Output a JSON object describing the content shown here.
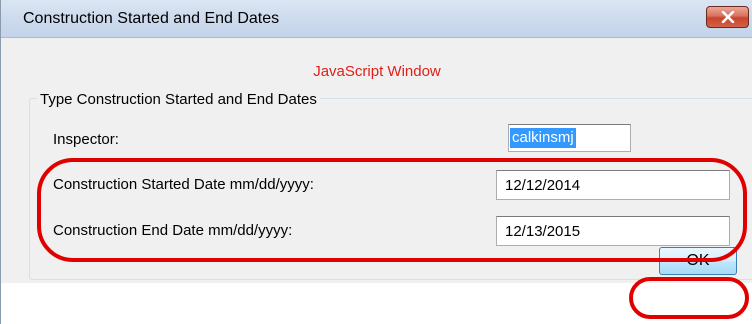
{
  "window": {
    "title": "Construction Started and End Dates"
  },
  "banner": {
    "text": "JavaScript Window",
    "color": "#e0201a"
  },
  "group": {
    "legend": "Type Construction Started and End Dates"
  },
  "fields": {
    "inspector_label": "Inspector:",
    "inspector_value": "calkinsmj",
    "start_label": "Construction Started Date mm/dd/yyyy:",
    "start_value": "12/12/2014",
    "end_label": "Construction End Date mm/dd/yyyy:",
    "end_value": "12/13/2015"
  },
  "buttons": {
    "ok_label": "OK"
  },
  "icons": {
    "close": "close-icon"
  },
  "colors": {
    "annotation": "#e00000",
    "selection": "#3399ff"
  }
}
